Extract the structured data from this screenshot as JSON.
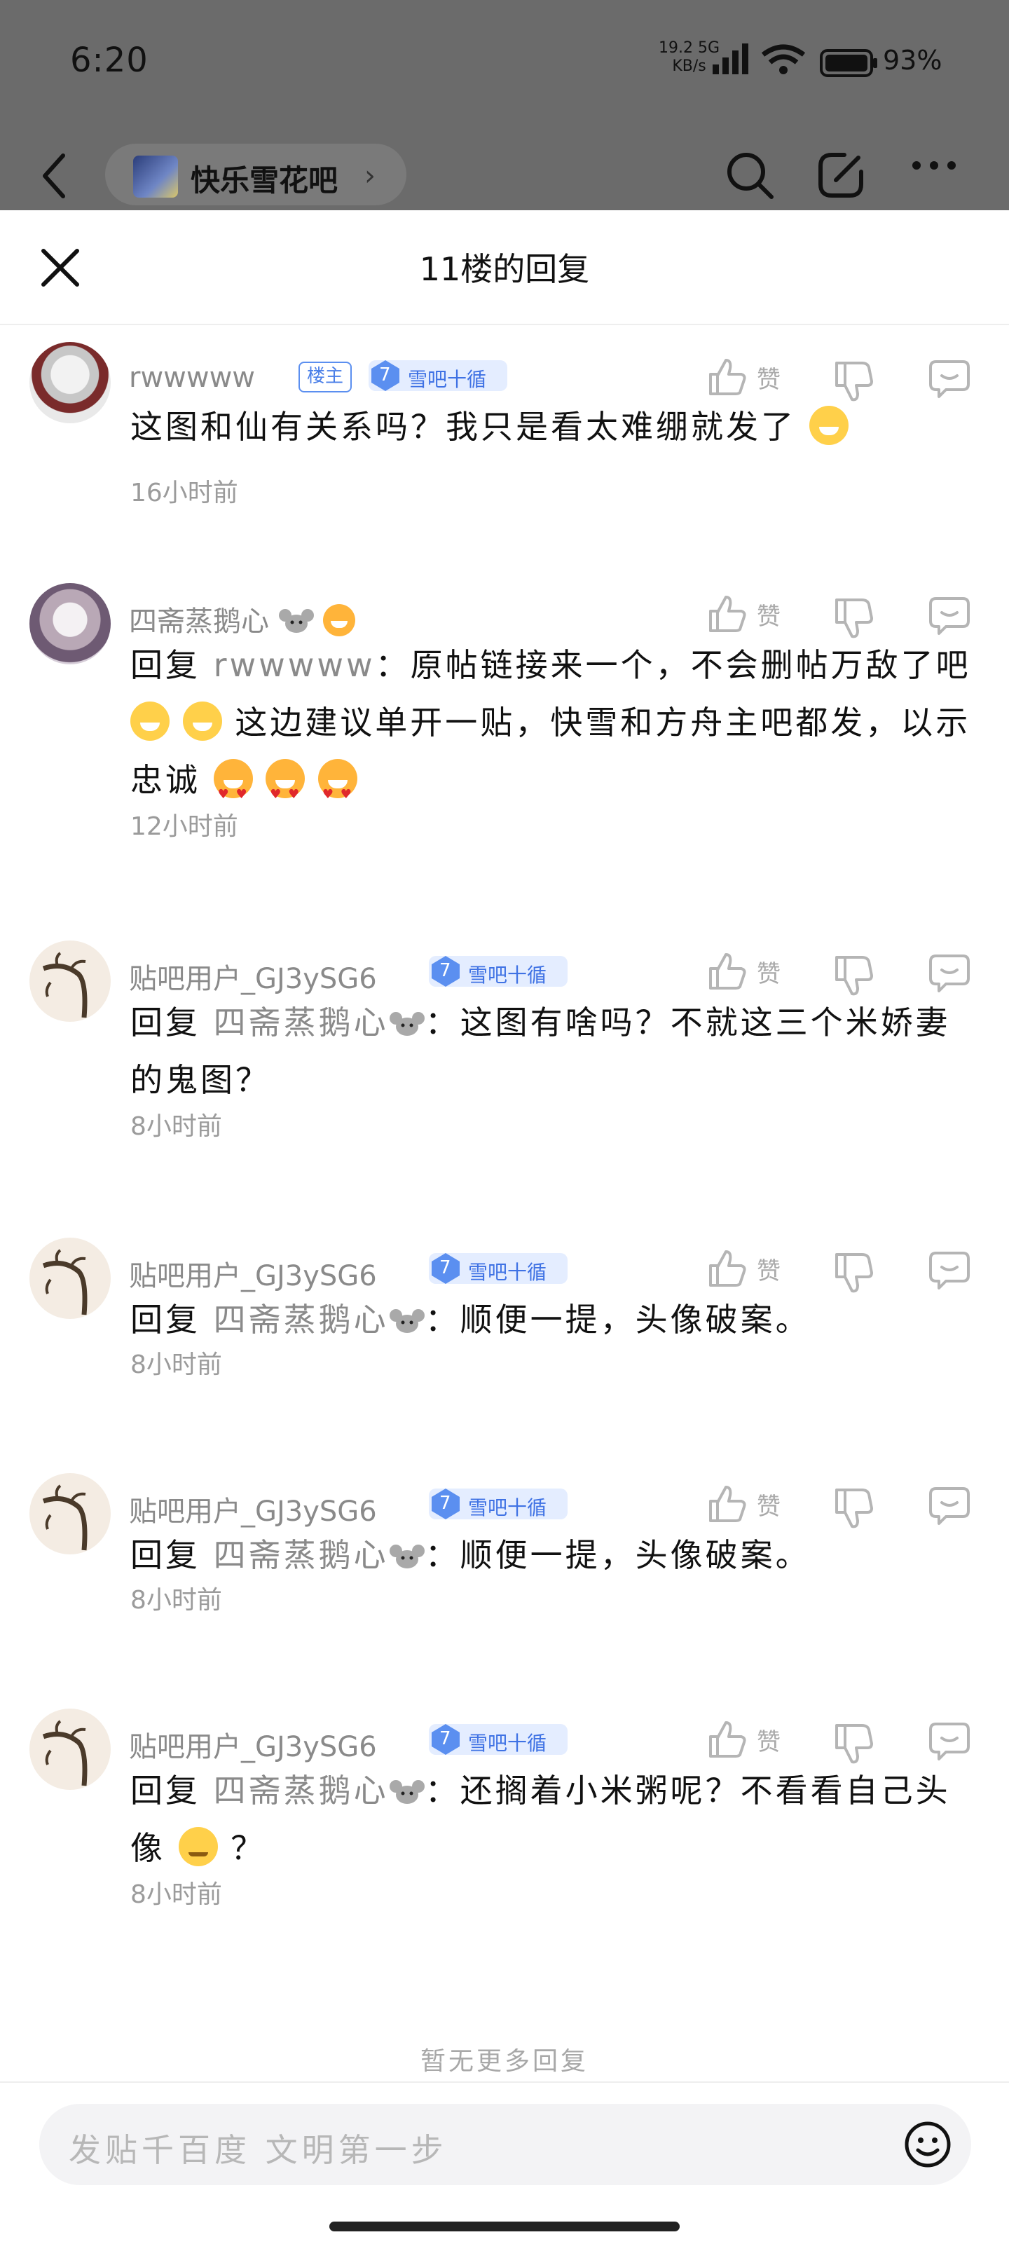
{
  "status_bar": {
    "time": "6:20",
    "net_speed": "19.2",
    "net_speed_unit": "KB/s",
    "network": "5G",
    "battery": "93%"
  },
  "nav": {
    "forum_name": "快乐雪花吧",
    "icons": [
      "back-icon",
      "search-icon",
      "edit-icon",
      "more-icon"
    ]
  },
  "sheet": {
    "title": "11楼的回复"
  },
  "actions": {
    "like_label": "赞"
  },
  "comments": [
    {
      "username": "rwwwww",
      "op_badge": "楼主",
      "level": "7",
      "level_title": "雪吧十循",
      "body": "这图和仙有关系吗？我只是看太难绷就发了",
      "time": "16小时前"
    },
    {
      "username": "四斋蒸鹅心",
      "reply_kw": "回复",
      "reply_to": "rwwwww",
      "body": "：原帖链接来一个，不会删帖万敌了吧",
      "body_2": "这边建议单开一贴，快雪和方舟主吧都发，以示忠诚",
      "time": "12小时前"
    },
    {
      "username": "贴吧用户_GJ3ySG6",
      "level": "7",
      "level_title": "雪吧十循",
      "reply_kw": "回复",
      "reply_to": "四斋蒸鹅心",
      "body": "：这图有啥吗？不就这三个米娇妻的鬼图？",
      "time": "8小时前"
    },
    {
      "username": "贴吧用户_GJ3ySG6",
      "level": "7",
      "level_title": "雪吧十循",
      "reply_kw": "回复",
      "reply_to": "四斋蒸鹅心",
      "body": "：顺便一提，头像破案。",
      "time": "8小时前"
    },
    {
      "username": "贴吧用户_GJ3ySG6",
      "level": "7",
      "level_title": "雪吧十循",
      "reply_kw": "回复",
      "reply_to": "四斋蒸鹅心",
      "body": "：顺便一提，头像破案。",
      "time": "8小时前"
    },
    {
      "username": "贴吧用户_GJ3ySG6",
      "level": "7",
      "level_title": "雪吧十循",
      "reply_kw": "回复",
      "reply_to": "四斋蒸鹅心",
      "body": "：还搁着小米粥呢？不看看自己头像",
      "body_2": "？",
      "time": "8小时前"
    }
  ],
  "footer": {
    "no_more": "暂无更多回复",
    "input_placeholder": "发贴千百度 文明第一步"
  },
  "colors": {
    "accent_blue": "#4a7fe8",
    "muted_gray": "#8a8a8a",
    "overlay": "#6b6b6b"
  }
}
